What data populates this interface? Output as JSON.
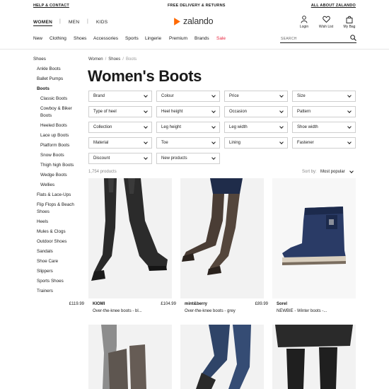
{
  "topbar": {
    "help": "HELP & CONTACT",
    "delivery": "FREE DELIVERY & RETURNS",
    "about": "ALL ABOUT ZALANDO"
  },
  "header": {
    "genders": [
      "WOMEN",
      "MEN",
      "KIDS"
    ],
    "logo_text": "zalando",
    "login": "Login",
    "wishlist": "Wish List",
    "bag": "My Bag",
    "nav": [
      "New",
      "Clothing",
      "Shoes",
      "Accessories",
      "Sports",
      "Lingerie",
      "Premium",
      "Brands",
      "Sale"
    ],
    "search_placeholder": "SEARCH",
    "accent_color": "#ff6900",
    "sale_color": "#e8263f"
  },
  "sidebar": {
    "items": [
      "Shoes",
      "Ankle Boots",
      "Ballet Pumps",
      "Boots",
      "Classic Boots",
      "Cowboy & Biker",
      "Boots",
      "Heeled Boots",
      "Lace up Boots",
      "Platform Boots",
      "Snow Boots",
      "Thigh high Boots",
      "Wedge Boots",
      "Wellies",
      "Flats & Lace-Ups",
      "Flip Flops & Beach",
      "Shoes",
      "Heels",
      "Mules & Clogs",
      "Outdoor Shoes",
      "Sandals",
      "Shoe Care",
      "Slippers",
      "Sports Shoes",
      "Trainers"
    ]
  },
  "breadcrumb": {
    "first": "Women",
    "second": "Shoes",
    "third": "Boots",
    "sep": "/"
  },
  "page_title": "Women's Boots",
  "filters": [
    "Brand",
    "Colour",
    "Price",
    "Size",
    "Type of heel",
    "Heel height",
    "Occasion",
    "Pattern",
    "Collection",
    "Leg height",
    "Leg width",
    "Shoe width",
    "Material",
    "Toe",
    "Lining",
    "Fastener",
    "Discount",
    "New products"
  ],
  "results": {
    "count": "1,754 products",
    "sort_label": "Sort by:",
    "sort_value": "Most popular"
  },
  "products": [
    {
      "brand": "KIOMI",
      "price": "£119.99",
      "desc": "Over-the-knee boots - bl..."
    },
    {
      "brand": "mint&berry",
      "price": "£104.99",
      "desc": "Over-the-knee boots - grey"
    },
    {
      "brand": "Sorel",
      "price": "£89.99",
      "desc": "NEWBIE - Winter boots -..."
    }
  ]
}
